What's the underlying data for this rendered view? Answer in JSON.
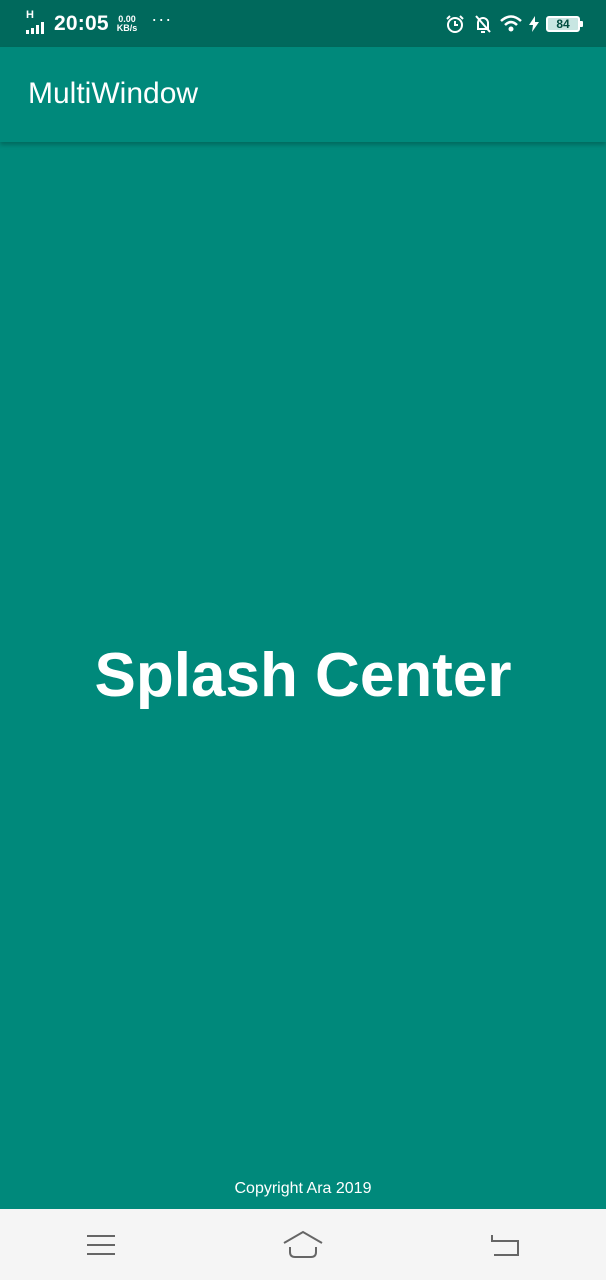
{
  "status_bar": {
    "network_type": "H",
    "time": "20:05",
    "net_speed_value": "0.00",
    "net_speed_unit": "KB/s",
    "more": "···",
    "battery_level": "84",
    "icons": [
      "signal-icon",
      "alarm-icon",
      "notifications-off-icon",
      "wifi-icon",
      "charging-icon",
      "battery-icon"
    ]
  },
  "app_bar": {
    "title": "MultiWindow"
  },
  "main": {
    "splash_title": "Splash Center",
    "copyright": "Copyright Ara 2019"
  },
  "nav_bar": {
    "buttons": [
      "menu-icon",
      "home-icon",
      "back-icon"
    ]
  },
  "colors": {
    "status_bar": "#00695c",
    "primary": "#00897b",
    "nav_bar": "#f5f5f5",
    "text": "#ffffff"
  }
}
